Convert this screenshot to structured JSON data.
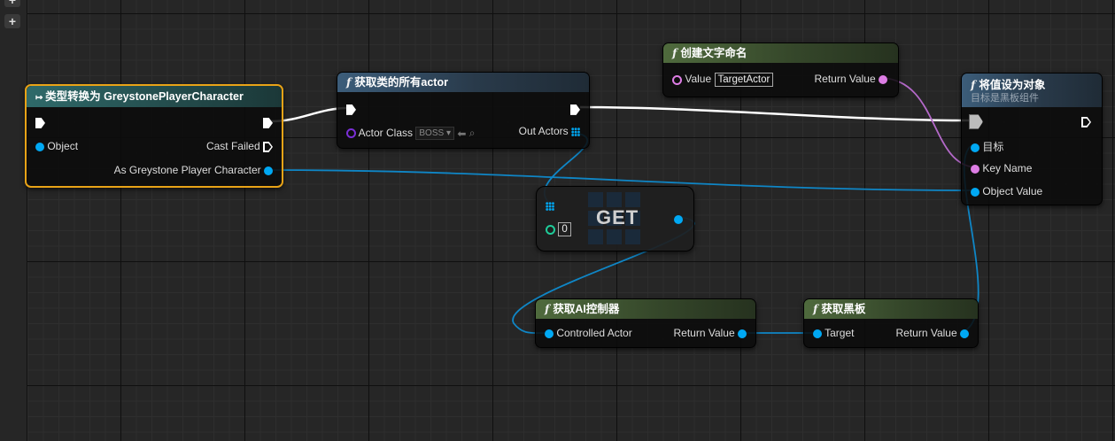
{
  "nodes": {
    "cast": {
      "title": "类型转换为 GreystonePlayerCharacter",
      "object_pin": "Object",
      "cast_failed_pin": "Cast Failed",
      "output_pin": "As Greystone Player Character"
    },
    "get_all_actors": {
      "icon": "f",
      "title_prefix": "获取类的所有",
      "title_suffix": "actor",
      "actor_class_pin": "Actor Class",
      "actor_class_value": "BOSS",
      "out_actors_pin": "Out Actors"
    },
    "make_literal_name": {
      "icon": "f",
      "title": "创建文字命名",
      "value_pin": "Value",
      "value_text": "TargetActor",
      "return_pin": "Return Value"
    },
    "set_value_as_object": {
      "icon": "f",
      "title": "将值设为对象",
      "subtitle": "目标是黑板组件",
      "target_pin": "目标",
      "key_name_pin": "Key Name",
      "object_value_pin": "Object Value"
    },
    "get": {
      "label": "GET",
      "index_value": "0"
    },
    "get_ai_controller": {
      "icon": "f",
      "title_prefix": "获取",
      "title_bold": "AI",
      "title_suffix": "控制器",
      "input_pin": "Controlled Actor",
      "return_pin": "Return Value"
    },
    "get_blackboard": {
      "icon": "f",
      "title": "获取黑板",
      "input_pin": "Target",
      "return_pin": "Return Value"
    }
  },
  "sidebar": {
    "expand_label": "+"
  },
  "colors": {
    "object_pin": "#00a8f3",
    "name_pin": "#dd7de4",
    "class_pin": "#7a2fd6",
    "int_pin": "#1fcc99",
    "exec_wire": "#ffffff",
    "selection": "#e8a317"
  }
}
